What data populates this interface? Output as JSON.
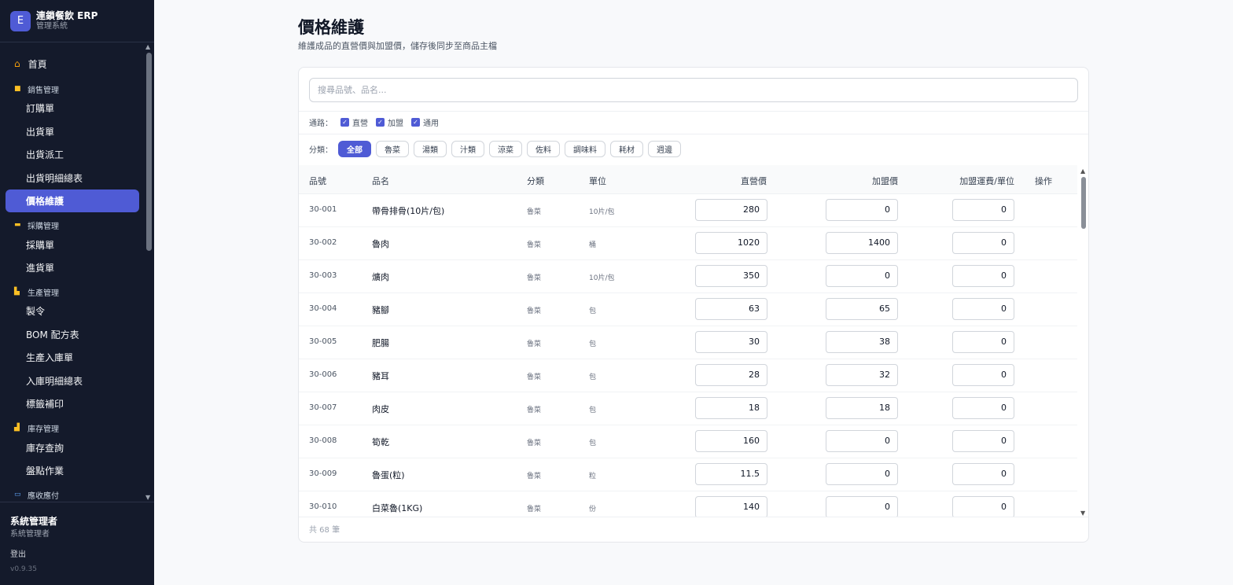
{
  "brand": {
    "logo_letter": "E",
    "title": "連鎖餐飲 ERP",
    "subtitle": "管理系統"
  },
  "sidebar": {
    "home": {
      "label": "首頁",
      "icon": "home-icon"
    },
    "sections": [
      {
        "label": "銷售管理",
        "icon": "box-icon",
        "items": [
          "訂購單",
          "出貨單",
          "出貨派工",
          "出貨明細總表",
          "價格維護"
        ]
      },
      {
        "label": "採購管理",
        "icon": "truck-icon",
        "items": [
          "採購單",
          "進貨單"
        ]
      },
      {
        "label": "生產管理",
        "icon": "factory-icon",
        "items": [
          "製令",
          "BOM 配方表",
          "生產入庫單",
          "入庫明細總表",
          "標籤補印"
        ]
      },
      {
        "label": "庫存管理",
        "icon": "warehouse-icon",
        "items": [
          "庫存查詢",
          "盤點作業"
        ]
      },
      {
        "label": "應收應付",
        "icon": "card-icon",
        "items": []
      }
    ],
    "active_item": "價格維護"
  },
  "footer": {
    "user_name": "系統管理者",
    "user_role": "系統管理者",
    "logout": "登出",
    "version": "v0.9.35"
  },
  "page": {
    "title": "價格維護",
    "subtitle": "維護成品的直營價與加盟價，儲存後同步至商品主檔"
  },
  "search": {
    "placeholder": "搜尋品號、品名...",
    "value": ""
  },
  "channels": {
    "label": "通路：",
    "options": [
      {
        "label": "直營",
        "checked": true
      },
      {
        "label": "加盟",
        "checked": true
      },
      {
        "label": "通用",
        "checked": true
      }
    ]
  },
  "categories": {
    "label": "分類：",
    "options": [
      "全部",
      "魯菜",
      "湯類",
      "汁類",
      "涼菜",
      "佐料",
      "調味料",
      "耗材",
      "週邊"
    ],
    "selected": "全部"
  },
  "table": {
    "headers": {
      "code": "品號",
      "name": "品名",
      "category": "分類",
      "unit": "單位",
      "direct_price": "直營價",
      "franchise_price": "加盟價",
      "franchise_shipping": "加盟運費/單位",
      "actions": "操作"
    },
    "rows": [
      {
        "code": "30-001",
        "name": "帶骨排骨(10片/包)",
        "category": "魯菜",
        "unit": "10片/包",
        "direct_price": "280",
        "franchise_price": "0",
        "shipping": "0"
      },
      {
        "code": "30-002",
        "name": "魯肉",
        "category": "魯菜",
        "unit": "桶",
        "direct_price": "1020",
        "franchise_price": "1400",
        "shipping": "0"
      },
      {
        "code": "30-003",
        "name": "爌肉",
        "category": "魯菜",
        "unit": "10片/包",
        "direct_price": "350",
        "franchise_price": "0",
        "shipping": "0"
      },
      {
        "code": "30-004",
        "name": "豬腳",
        "category": "魯菜",
        "unit": "包",
        "direct_price": "63",
        "franchise_price": "65",
        "shipping": "0"
      },
      {
        "code": "30-005",
        "name": "肥腸",
        "category": "魯菜",
        "unit": "包",
        "direct_price": "30",
        "franchise_price": "38",
        "shipping": "0"
      },
      {
        "code": "30-006",
        "name": "豬耳",
        "category": "魯菜",
        "unit": "包",
        "direct_price": "28",
        "franchise_price": "32",
        "shipping": "0"
      },
      {
        "code": "30-007",
        "name": "肉皮",
        "category": "魯菜",
        "unit": "包",
        "direct_price": "18",
        "franchise_price": "18",
        "shipping": "0"
      },
      {
        "code": "30-008",
        "name": "筍乾",
        "category": "魯菜",
        "unit": "包",
        "direct_price": "160",
        "franchise_price": "0",
        "shipping": "0"
      },
      {
        "code": "30-009",
        "name": "魯蛋(粒)",
        "category": "魯菜",
        "unit": "粒",
        "direct_price": "11.5",
        "franchise_price": "0",
        "shipping": "0"
      },
      {
        "code": "30-010",
        "name": "白菜魯(1KG)",
        "category": "魯菜",
        "unit": "份",
        "direct_price": "140",
        "franchise_price": "0",
        "shipping": "0"
      }
    ],
    "total_text": "共 68 筆"
  },
  "colors": {
    "accent": "#4f5bd5",
    "sidebar_bg": "#141a2b"
  }
}
